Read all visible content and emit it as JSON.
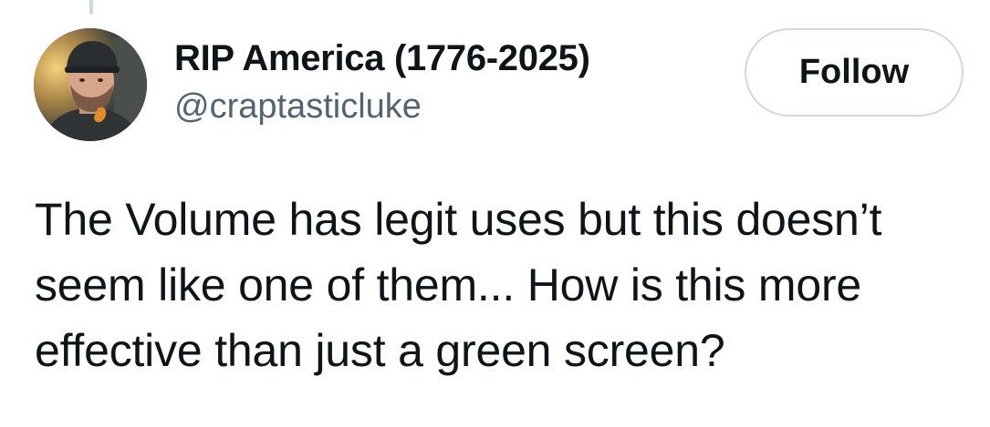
{
  "tweet": {
    "author": {
      "display_name": "RIP America (1776-2025)",
      "handle": "@craptasticluke",
      "avatar_icon": "profile-photo"
    },
    "follow_label": "Follow",
    "text_lines": [
      "The Volume has legit uses but this doesn’t",
      "seem like one of them... How is this more",
      "effective than just a green screen?"
    ]
  },
  "colors": {
    "text_primary": "#0f1419",
    "text_secondary": "#536471",
    "border": "#cfd9de",
    "background": "#ffffff"
  }
}
